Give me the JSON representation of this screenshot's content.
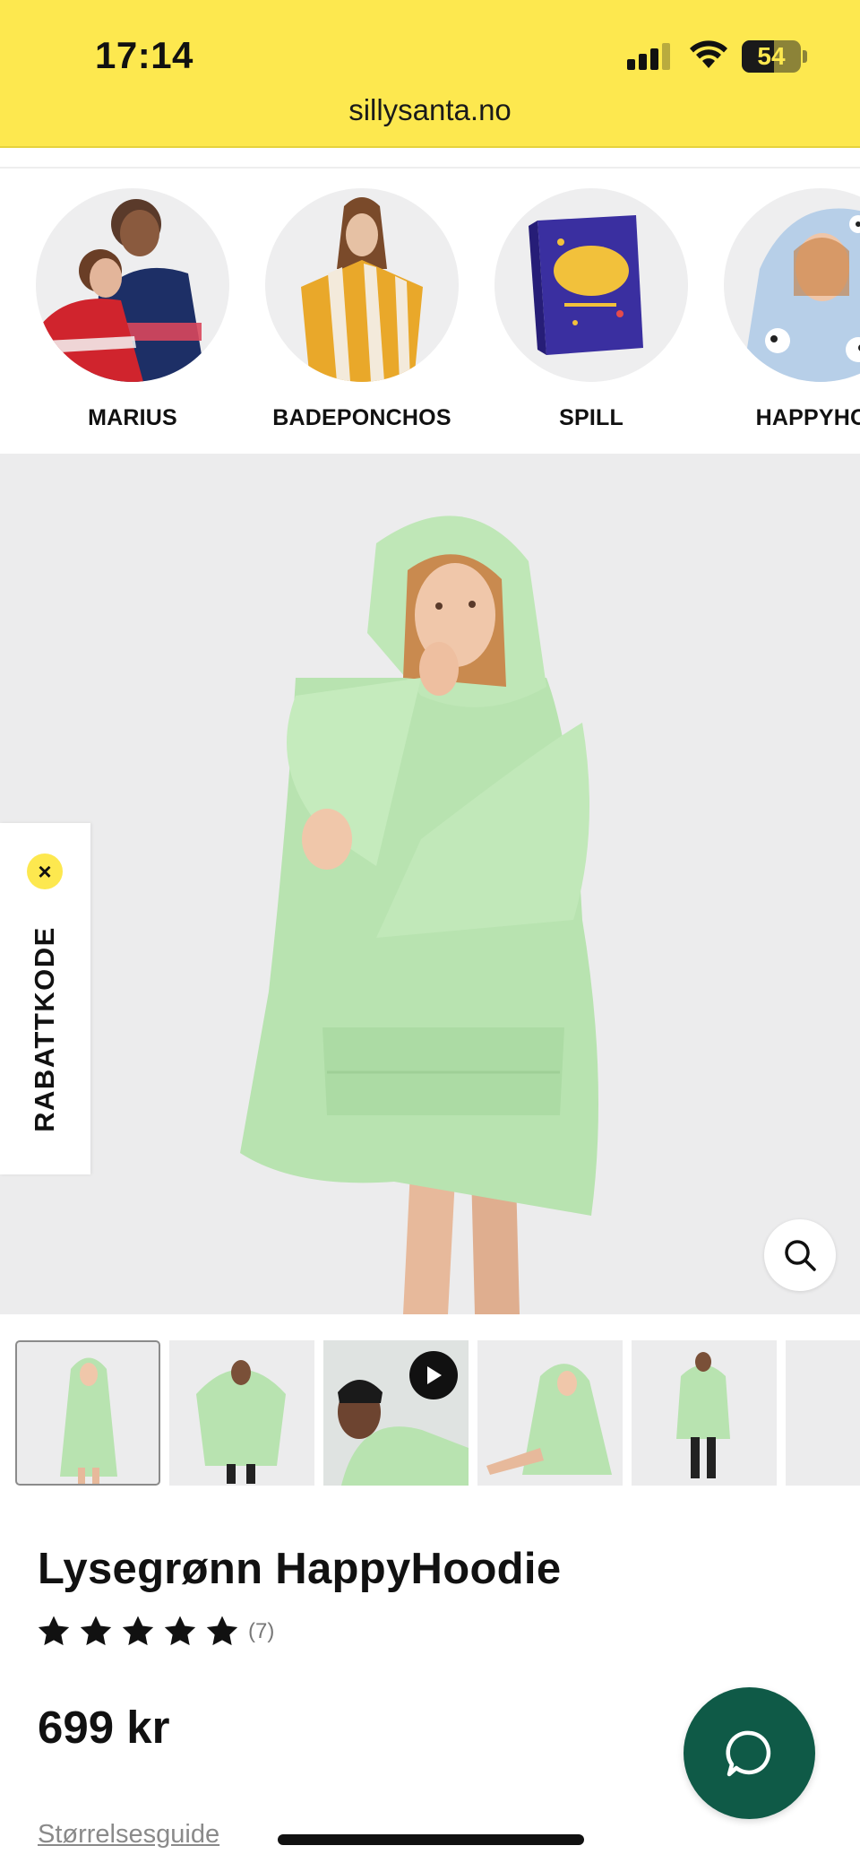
{
  "status_bar": {
    "time": "17:14",
    "battery": "54",
    "signal_bars_active": 3,
    "signal_bars_total": 4
  },
  "browser": {
    "url": "sillysanta.no"
  },
  "categories": [
    {
      "label": "MARIUS",
      "icon": "couple-in-knit-sweaters-image"
    },
    {
      "label": "BADEPONCHOS",
      "icon": "woman-in-striped-poncho-image"
    },
    {
      "label": "SPILL",
      "icon": "kazoo-star-game-box-image"
    },
    {
      "label": "HAPPYHOO",
      "icon": "woman-in-panda-hoodie-image"
    }
  ],
  "discount_tab": {
    "label": "RABATTKODE",
    "close_icon": "close-icon"
  },
  "product": {
    "title": "Lysegrønn HappyHoodie",
    "rating": 5,
    "rating_max": 5,
    "review_count": "(7)",
    "price": "699 kr",
    "size_guide_label": "Størrelsesguide",
    "hoodie_color": "#b8e3b0"
  },
  "thumbnails": [
    {
      "name": "thumb-front-woman",
      "active": true,
      "video": false
    },
    {
      "name": "thumb-front-man",
      "active": false,
      "video": false
    },
    {
      "name": "thumb-video-closeup",
      "active": false,
      "video": true
    },
    {
      "name": "thumb-sitting-woman",
      "active": false,
      "video": false
    },
    {
      "name": "thumb-full-length-man",
      "active": false,
      "video": false
    },
    {
      "name": "thumb-partial",
      "active": false,
      "video": false
    }
  ],
  "colors": {
    "topbar": "#fde84f",
    "chat_button": "#0f5a47",
    "image_background": "#ececed"
  }
}
